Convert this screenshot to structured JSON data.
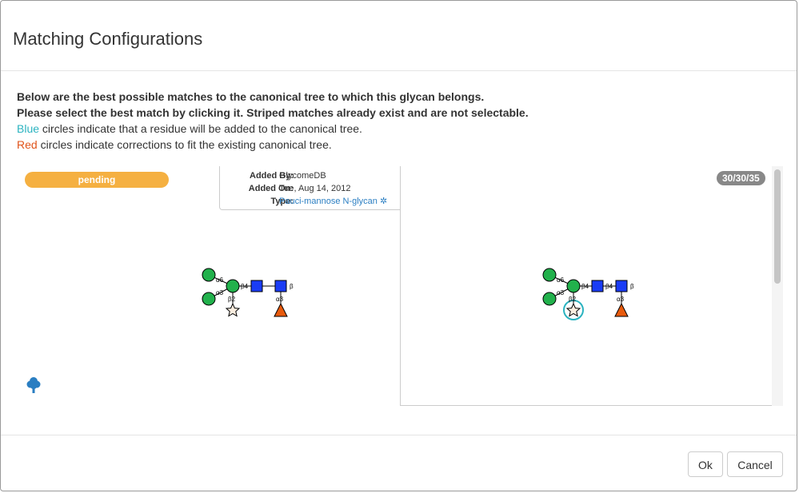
{
  "dialog": {
    "title": "Matching Configurations"
  },
  "intro": {
    "line1": "Below are the best possible matches to the canonical tree to which this glycan belongs.",
    "line2": "Please select the best match by clicking it. Striped matches already exist and are not selectable.",
    "line3_colored": "Blue",
    "line3_rest": " circles indicate that a residue will be added to the canonical tree.",
    "line4_colored": "Red",
    "line4_rest": " circles indicate corrections to fit the existing canonical tree."
  },
  "match_left": {
    "status_badge": "pending",
    "added_by_label": "Added By:",
    "added_by_value": "GlycomeDB",
    "added_on_label": "Added On:",
    "added_on_value": "Tue, Aug 14, 2012",
    "type_label": "Type:",
    "type_value": "Pauci-mannose N-glycan",
    "linkages": {
      "a6": "α6",
      "a3": "α3",
      "b4": "β4",
      "b2": "β2",
      "a3_fuc": "α3",
      "beta": "β"
    }
  },
  "match_right": {
    "counter": "30/30/35",
    "linkages": {
      "a6": "α6",
      "a3": "α3",
      "b4a": "β4",
      "b4b": "β4",
      "b2": "β2",
      "a3_fuc": "α3",
      "beta": "β"
    }
  },
  "footer": {
    "ok_label": "Ok",
    "cancel_label": "Cancel"
  },
  "colors": {
    "mannose": "#22b14c",
    "glcnac": "#1a3cf5",
    "fucose": "#e85a0c",
    "xylose_star": "#fbeee0",
    "added_ring": "#2bb3c0",
    "pending": "#f5b041",
    "link": "#2a7ec2"
  }
}
